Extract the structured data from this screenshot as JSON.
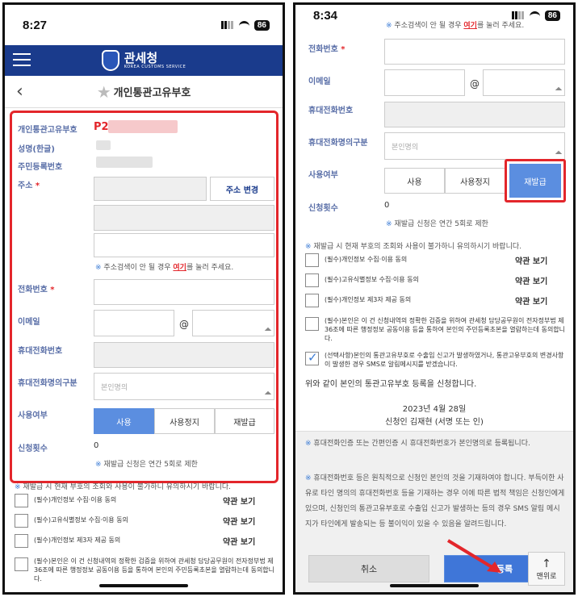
{
  "left": {
    "status": {
      "time": "8:27",
      "battery": "86"
    },
    "header": {
      "brand_ko": "관세청",
      "brand_en": "KOREA CUSTOMS SERVICE",
      "page_title": "개인통관고유부호"
    },
    "fields": {
      "code_label": "개인통관고유부호",
      "code_value": "P2",
      "name_label": "성명(한글)",
      "rrn_label": "주민등록번호",
      "address_label": "주소",
      "required": "*",
      "address_change_button": "주소 변경",
      "address_note_pre": "주소검색이 안 될 경우",
      "address_note_link": "여기",
      "address_note_post": "를 눌러 주세요.",
      "phone_label": "전화번호",
      "email_label": "이메일",
      "at": "@",
      "mobile_label": "휴대전화번호",
      "owner_label": "휴대전화명의구분",
      "owner_placeholder": "본인명의",
      "usage_label": "사용여부",
      "usage_options": [
        "사용",
        "사용정지",
        "재발급"
      ],
      "count_label": "신청횟수",
      "count_value": "0",
      "count_note": "재발급 신청은 연간 5회로 제한"
    },
    "warning": "재발급 시 현재 부호의 조회와 사용이 불가하니 유의하시기 바랍니다.",
    "consents": [
      {
        "text": "(필수)개인정보 수집·이용 동의",
        "terms": "약관 보기"
      },
      {
        "text": "(필수)고유식별정보 수집·이용 동의",
        "terms": "약관 보기"
      },
      {
        "text": "(필수)개인정보 제3자 제공 동의",
        "terms": "약관 보기"
      },
      {
        "text": "(필수)본인은 이 건 신청내역의 정확한 검증을 위하여 관세청 담당공무원이 전자정부법 제 36조에 따른 행정정보 공동이용 등을 통하여 본인의 주민등록초본을 열람하는데 동의합니다."
      }
    ]
  },
  "right": {
    "status": {
      "time": "8:34",
      "battery": "86"
    },
    "top_note_pre": "주소검색이 안 될 경우",
    "top_note_link": "여기",
    "top_note_post": "를 눌러 주세요.",
    "phone_label": "전화번호",
    "required": "*",
    "email_label": "이메일",
    "at": "@",
    "mobile_label": "휴대전화번호",
    "owner_label": "휴대전화명의구분",
    "owner_placeholder": "본인명의",
    "usage_label": "사용여부",
    "usage_options": [
      "사용",
      "사용정지",
      "재발급"
    ],
    "count_label": "신청횟수",
    "count_value": "0",
    "count_note": "재발급 신청은 연간 5회로 제한",
    "warning": "재발급 시 현재 부호의 조회와 사용이 불가하니 유의하시기 바랍니다.",
    "consents": [
      {
        "text": "(필수)개인정보 수집·이용 동의",
        "terms": "약관 보기"
      },
      {
        "text": "(필수)고유식별정보 수집·이용 동의",
        "terms": "약관 보기"
      },
      {
        "text": "(필수)개인정보 제3자 제공 동의",
        "terms": "약관 보기"
      },
      {
        "text": "(필수)본인은 이 건 신청내역의 정확한 검증을 위하여 관세청 담당공무원이 전자정부법 제 36조에 따른 행정정보 공동이용 등을 통하여 본인의 주민등록초본을 열람하는데 동의합니다."
      },
      {
        "text": "(선택사항)본인의 통관고유부호로 수출입 신고가 발생하였거나, 통관고유부호의 변경사항이 발생한 경우 SMS로 알림메시지를 받겠습니다."
      }
    ],
    "declaration": "위와 같이 본인의 통관고유부호 등록을 신청합니다.",
    "date": "2023년 4월 28일",
    "signature": "신청인 김재현 (서명 또는 인)",
    "info1": "휴대전화인증 또는 간편인증 시 휴대전화번호가 본인명의로 등록됩니다.",
    "info2": "휴대전화번호 등은 원칙적으로 신청인 본인의 것을 기재하여야 합니다. 부득이한 사유로 타인 명의의 휴대전화번호 등을 기재하는 경우 이에 따른 법적 책임은 신청인에게 있으며, 신청인의 통관고유부호로 수출입 신고가 발생하는 등의 경우 SMS 알림 메시지가 타인에게 발송되는 등 불이익이 있을 수 있음을 알려드립니다.",
    "cancel_button": "취소",
    "submit_button": "등록",
    "top_button": "맨위로"
  },
  "colors": {
    "highlight": "#e3262b",
    "accent": "#5b8ee0",
    "header": "#1a3b8c"
  }
}
